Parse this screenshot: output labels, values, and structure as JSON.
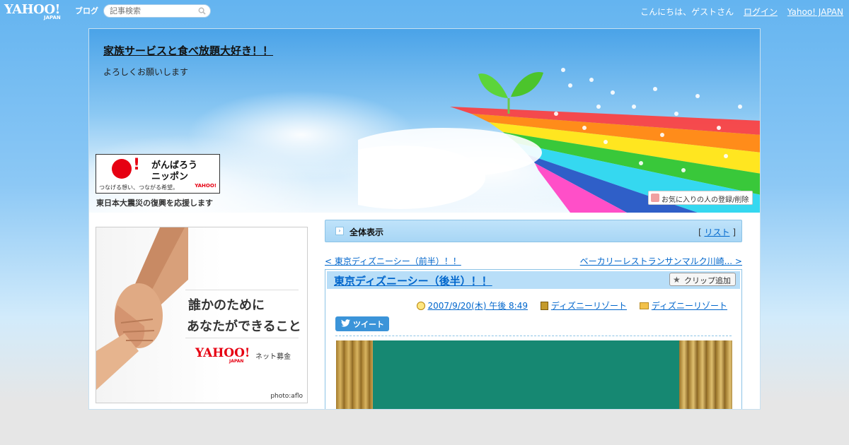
{
  "topbar": {
    "logo_yahoo": "YAHOO!",
    "logo_japan": "JAPAN",
    "logo_blog": "ブログ",
    "search_placeholder": "記事検索",
    "greeting": "こんにちは、ゲストさん",
    "login": "ログイン",
    "yahoo_japan": "Yahoo! JAPAN"
  },
  "header": {
    "blog_title": "家族サービスと食べ放題大好き！！",
    "blog_subtitle": "よろしくお願いします",
    "favorite_button": "お気に入りの人の登録/削除"
  },
  "sidebar": {
    "ganbarou": {
      "exclaim": "!",
      "line1": "がんばろう",
      "line2": "ニッポン",
      "line3": "つなげる想い、つながる希望。",
      "yahoo": "YAHOO!",
      "caption": "東日本大震災の復興を応援します"
    },
    "ad": {
      "line1": "誰かのために",
      "line2": "あなたができること",
      "yahoo": "YAHOO!",
      "japan": "JAPAN",
      "suffix": "ネット募金",
      "credit": "photo:aflo"
    }
  },
  "main": {
    "view_all_label": "全体表示",
    "list_prefix": "[ ",
    "list_link": "リスト",
    "list_suffix": " ]",
    "prev_link": "< 東京ディズニーシー（前半）！！",
    "next_link": "ベーカリーレストランサンマルク川崎... >",
    "entry": {
      "title": "東京ディズニーシー（後半）！！",
      "clip_button": "クリップ追加",
      "date": "2007/9/20(木) 午後 8:49",
      "category": "ディズニーリゾート",
      "folder": "ディズニーリゾート",
      "tweet": "ツイート"
    }
  },
  "colors": {
    "accent": "#0066cc",
    "header_bar": "#b8def8",
    "sky": "#64b4f0"
  }
}
